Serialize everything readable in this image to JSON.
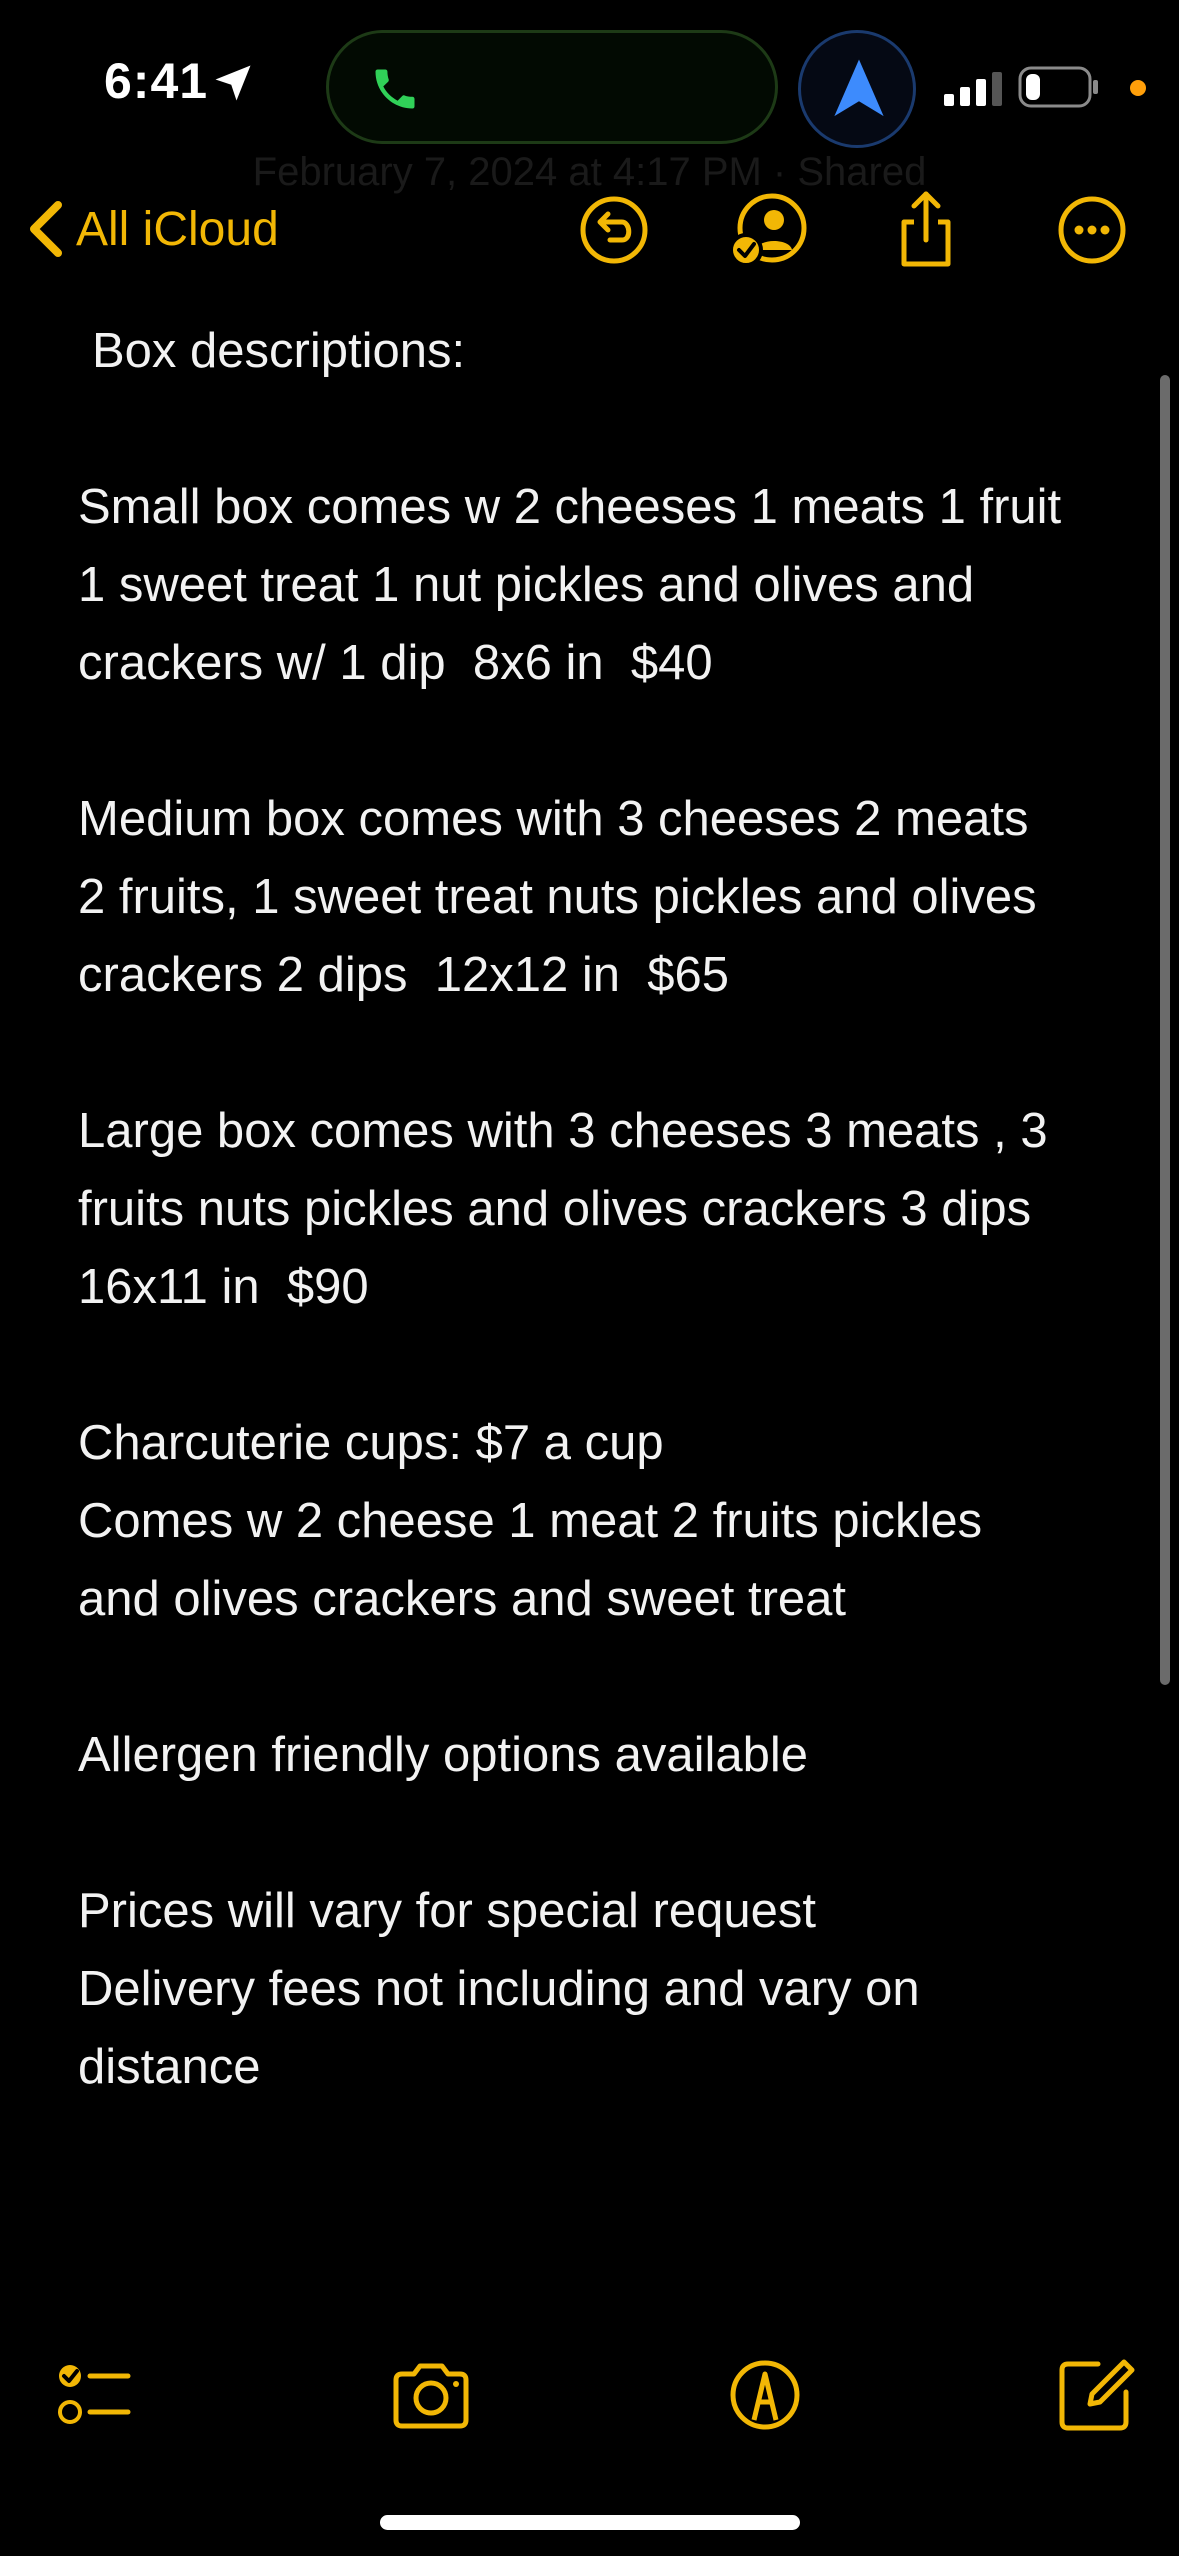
{
  "status_bar": {
    "time": "6:41",
    "accent": "#ff9f0a",
    "call_color": "#30d158"
  },
  "nav": {
    "back_label": "All iCloud",
    "date_hint": "February 7, 2024 at 4:17 PM · Shared",
    "accent": "#f2b705",
    "icons": [
      "undo-icon",
      "collaborate-icon",
      "share-icon",
      "more-icon"
    ]
  },
  "note": {
    "title": "Box descriptions:",
    "paragraphs": [
      "Small box comes w 2 cheeses 1 meats 1 fruit\n1 sweet treat 1 nut pickles and olives and\ncrackers w/ 1 dip  8x6 in  $40",
      "Medium box comes with 3 cheeses 2 meats\n2 fruits, 1 sweet treat nuts pickles and olives\ncrackers 2 dips  12x12 in  $65",
      "Large box comes with 3 cheeses 3 meats , 3\nfruits nuts pickles and olives crackers 3 dips\n16x11 in  $90",
      "Charcuterie cups: $7 a cup\nComes w 2 cheese 1 meat 2 fruits pickles\nand olives crackers and sweet treat",
      "Allergen friendly options available",
      "Prices will vary for special request\nDelivery fees not including and vary on\ndistance"
    ]
  },
  "toolbar": {
    "icons": [
      "checklist-icon",
      "camera-icon",
      "markup-icon",
      "compose-icon"
    ]
  }
}
